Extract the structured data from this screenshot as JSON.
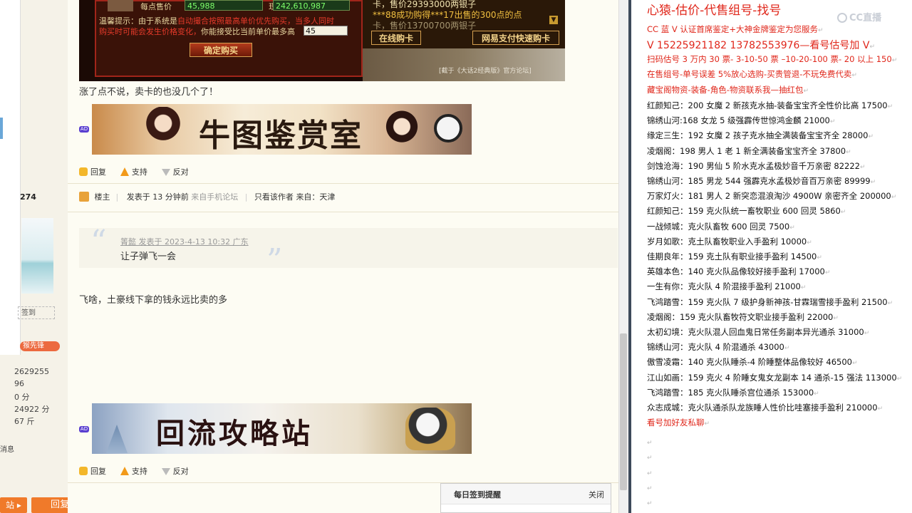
{
  "game": {
    "label_price": "每点售价",
    "price": "45,988",
    "label_cash": "现金",
    "cash": "242,610,987",
    "hint_label": "温馨提示：",
    "hint_text": "由于系统是",
    "hint_red": "自动撮合按照最高单价优先购买，当多人同时",
    "hint_red2": "购买时可能会发生价格变化，",
    "hint_text2": "你能接受比当前单价最多高",
    "max_input": "45",
    "confirm": "确定购买",
    "notice1": "卡，售价29393000两银子",
    "notice2a": "***88成功购得",
    "notice2b": "***17出售的",
    "notice2c": "300点的点",
    "notice3": "卡，售价13700700两银子",
    "online_buy": "在线购卡",
    "netease_buy": "网易支付快速购卡",
    "caption": "[截于《大话2经典版》官方论坛]"
  },
  "post1": {
    "text": "涨了点不说，卖卡的也没几个了！"
  },
  "ad": {
    "badge": "AD",
    "banner1": "牛图鉴赏室",
    "banner2": "回流攻略站"
  },
  "actions": {
    "reply": "回复",
    "support": "支持",
    "oppose": "反对"
  },
  "meta": {
    "author_role": "楼主",
    "posted": "发表于 13 分钟前",
    "source": "来自手机论坛",
    "only_author": "只看该作者",
    "from": "来自：天津"
  },
  "quote": {
    "header": "箐懿 发表于 2023-4-13 10:32 广东",
    "text": "让子弹飞一会"
  },
  "post2": {
    "text": "飞啥，土豪线下拿的钱永远比卖的多"
  },
  "left": {
    "num_274": "274",
    "sign_label": "签到",
    "promo": "猴先锋",
    "stats": [
      "2629255",
      "96",
      "0 分",
      "24922 分",
      "67 斤"
    ],
    "info": "消息",
    "bottom_btn1": "站",
    "bottom_btn2": "回复"
  },
  "checkin": {
    "title": "每日签到提醒",
    "close": "关闭"
  },
  "right": {
    "title": "心猿-估价-代售组号-找号",
    "cc_logo": "CC直播",
    "lines": [
      {
        "t": "CC 蓝 V 认证首席鉴定+大神金牌鉴定为您服务",
        "c": "red"
      },
      {
        "t": "V 15225921182      13782553976—看号估号加 V",
        "c": "red"
      },
      {
        "t": "扫码估号 3 万内 30 票- 3-10-50 票  –10-20-100 票- 20 以上 150",
        "c": "red"
      },
      {
        "t": "在售组号-单号误差 5%放心选购-买贵管退-不玩免费代卖",
        "c": "red"
      },
      {
        "t": "藏宝阁物资-装备-角色-物资联系我—抽红包",
        "c": "red"
      },
      {
        "t": "红颜知己：200 女魔 2 新孩克水抽-装备宝宝齐全性价比高 17500",
        "c": "blk"
      },
      {
        "t": "锦绣山河:168 女龙 5 级强霹传世惊鸿金麟 21000",
        "c": "blk"
      },
      {
        "t": "缘定三生：192 女魔 2 孩子克水抽全满装备宝宝齐全 28000",
        "c": "blk"
      },
      {
        "t": "凌烟阁：198 男人 1 老 1 新全满装备宝宝齐全 37800",
        "c": "blk"
      },
      {
        "t": "剑蚀沧海：190 男仙 5 阶水克水孟极妙音千万亲密 82222",
        "c": "blk"
      },
      {
        "t": "锦绣山河：185 男龙 544 强霹克水孟极妙音百万亲密 89999",
        "c": "blk"
      },
      {
        "t": "万家灯火：181 男人 2 新突恋混浪淘沙 4900W 亲密齐全 200000",
        "c": "blk"
      },
      {
        "t": "红颜知己：159 克火队统一畜牧职业 600 回灵 5860",
        "c": "blk"
      },
      {
        "t": "一战倾城：克火队畜牧 600 回灵 7500",
        "c": "blk"
      },
      {
        "t": "岁月如歌：克土队畜牧职业入手盈利 10000",
        "c": "blk"
      },
      {
        "t": "佳期良年：159 克土队有职业接手盈利 14500",
        "c": "blk"
      },
      {
        "t": "英雄本色：140 克火队品像较好接手盈利 17000",
        "c": "blk"
      },
      {
        "t": "一生有你：克火队 4 阶混接手盈利 21000",
        "c": "blk"
      },
      {
        "t": "飞鸿踏雪：159 克火队 7 级护身新神孩-甘霖瑞雪接手盈利 21500",
        "c": "blk"
      },
      {
        "t": "凌烟阁：159 克火队畜牧符文职业接手盈利 22000",
        "c": "blk"
      },
      {
        "t": "太初幻境：克火队混人回血鬼日常任务副本异光通杀 31000",
        "c": "blk"
      },
      {
        "t": "锦绣山河：克火队 4 阶混通杀 43000",
        "c": "blk"
      },
      {
        "t": "傲雪凌霜：140 克火队睡杀-4 阶睡整体品像较好 46500",
        "c": "blk"
      },
      {
        "t": "江山如画：159 克火 4 阶睡女鬼女龙副本 14 通杀-15 强法 113000",
        "c": "blk"
      },
      {
        "t": "飞鸿踏雪：185 克火队睡杀宫位通杀 153000",
        "c": "blk"
      },
      {
        "t": "众志成城：克火队通杀队龙族睡人性价比哇塞接手盈利 210000",
        "c": "blk"
      },
      {
        "t": "看号加好友私聊",
        "c": "red"
      }
    ]
  }
}
